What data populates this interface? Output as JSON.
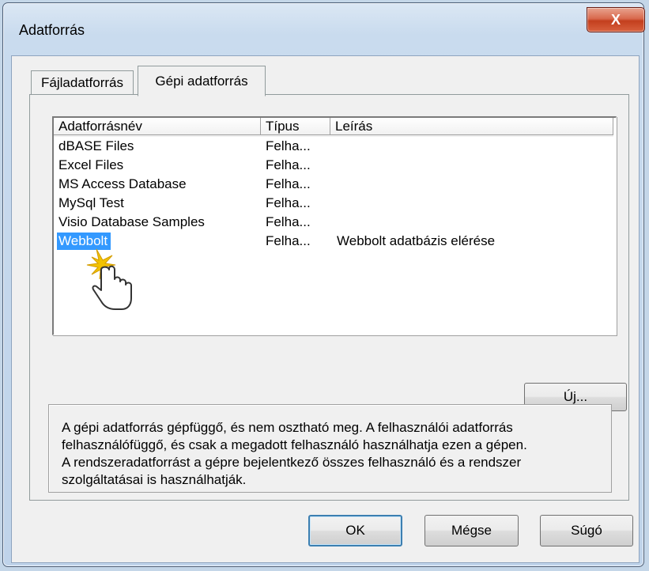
{
  "window": {
    "title": "Adatforrás",
    "close_label": "X"
  },
  "tabs": [
    {
      "label": "Fájladatforrás"
    },
    {
      "label": "Gépi adatforrás"
    }
  ],
  "list": {
    "columns": [
      "Adatforrásnév",
      "Típus",
      "Leírás"
    ],
    "rows": [
      {
        "name": "dBASE Files",
        "type": "Felha...",
        "description": ""
      },
      {
        "name": "Excel Files",
        "type": "Felha...",
        "description": ""
      },
      {
        "name": "MS Access Database",
        "type": "Felha...",
        "description": ""
      },
      {
        "name": "MySql Test",
        "type": "Felha...",
        "description": ""
      },
      {
        "name": "Visio Database Samples",
        "type": "Felha...",
        "description": ""
      },
      {
        "name": "Webbolt",
        "type": "Felha...",
        "description": "Webbolt adatbázis elérése",
        "selected": true
      }
    ]
  },
  "buttons": {
    "new": "Új...",
    "ok": "OK",
    "cancel": "Mégse",
    "help": "Súgó"
  },
  "info": {
    "lines": [
      "A gépi adatforrás gépfüggő, és nem osztható meg.  A felhasználói adatforrás",
      "felhasználófüggő, és csak a megadott felhasználó használhatja ezen a gépen.",
      "A rendszeradatforrást a gépre bejelentkező összes felhasználó és a rendszer",
      "szolgáltatásai is használhatják."
    ]
  },
  "colors": {
    "selection": "#3399ff",
    "close": "#c33f1e",
    "frame": "#bfd3ea"
  },
  "icons": {
    "cursor": "hand-pointer-icon"
  }
}
